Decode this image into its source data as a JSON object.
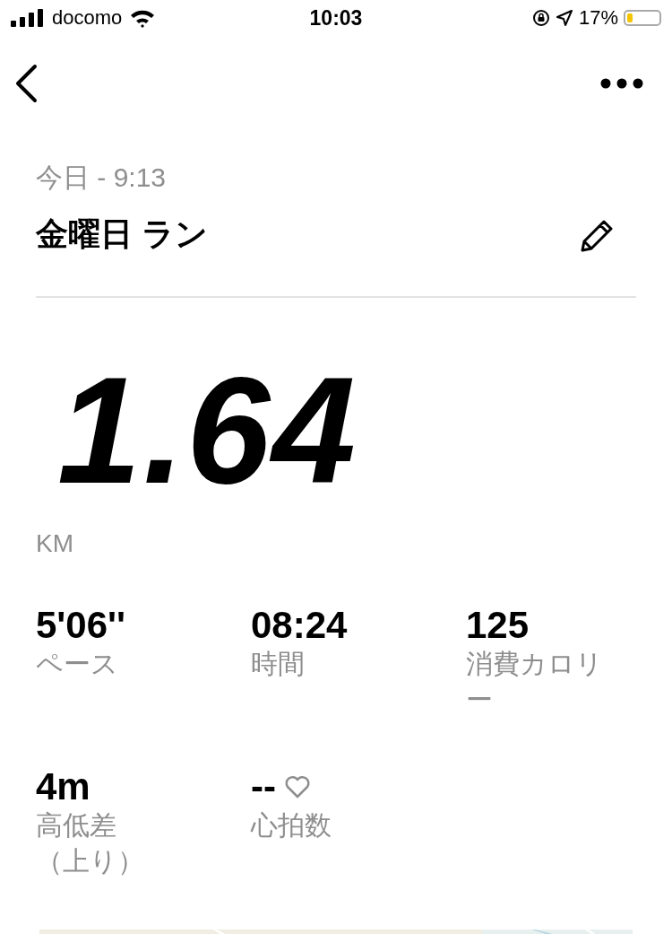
{
  "status_bar": {
    "carrier": "docomo",
    "time": "10:03",
    "battery": "17%"
  },
  "activity": {
    "date": "今日 - 9:13",
    "title": "金曜日 ラン",
    "distance": "1.64",
    "unit": "KM"
  },
  "stats": [
    {
      "value": "5'06''",
      "label": "ペース",
      "heart": false
    },
    {
      "value": "08:24",
      "label": "時間",
      "heart": false
    },
    {
      "value": "125",
      "label": "消費カロリー",
      "heart": false
    },
    {
      "value": "4m",
      "label": "高低差（上り）",
      "heart": false
    },
    {
      "value": "--",
      "label": "心拍数",
      "heart": true
    }
  ]
}
